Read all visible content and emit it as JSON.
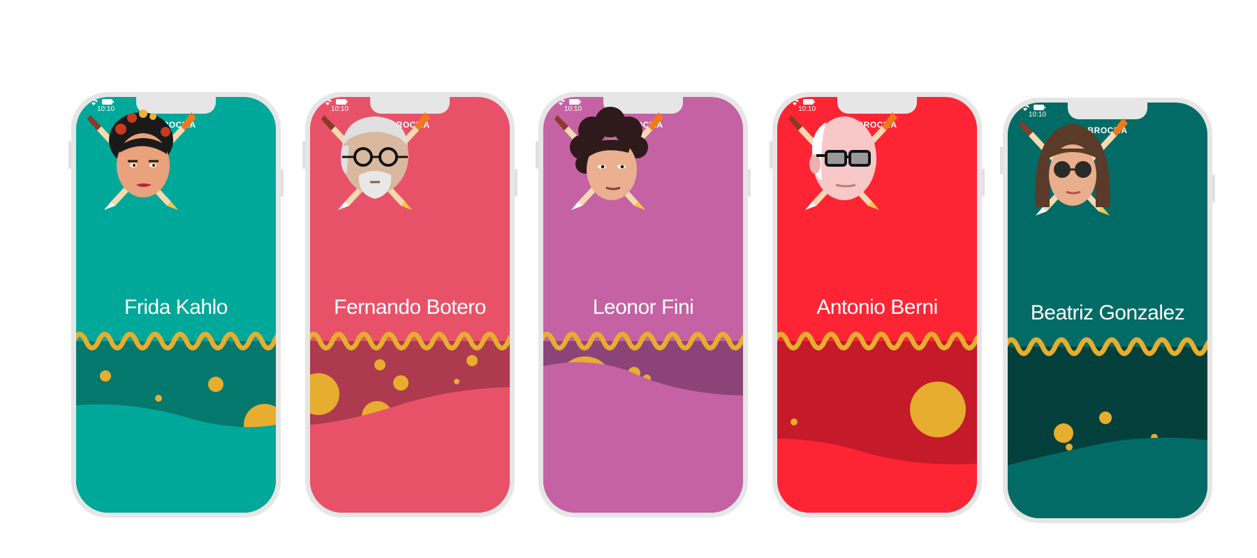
{
  "status_bar": {
    "time": "10:10"
  },
  "app": {
    "brand": "BROCMA"
  },
  "colors": {
    "wave_accent": "#e7ad2e",
    "phone_frame": "#e6e6e6"
  },
  "cards": [
    {
      "name": "Frida Kahlo",
      "theme": {
        "top": "#00a89a",
        "mid": "#05786d",
        "bottom": "#00a89a"
      }
    },
    {
      "name": "Fernando Botero",
      "theme": {
        "top": "#e85268",
        "mid": "#ad3a4e",
        "bottom": "#e85268"
      }
    },
    {
      "name": "Leonor Fini",
      "theme": {
        "top": "#c462a4",
        "mid": "#8c4478",
        "bottom": "#c462a4"
      }
    },
    {
      "name": "Antonio Berni",
      "theme": {
        "top": "#fd2534",
        "mid": "#c41a2a",
        "bottom": "#fd2534"
      }
    },
    {
      "name": "Beatriz Gonzalez",
      "theme": {
        "top": "#036b65",
        "mid": "#03403b",
        "bottom": "#036b65"
      }
    }
  ]
}
